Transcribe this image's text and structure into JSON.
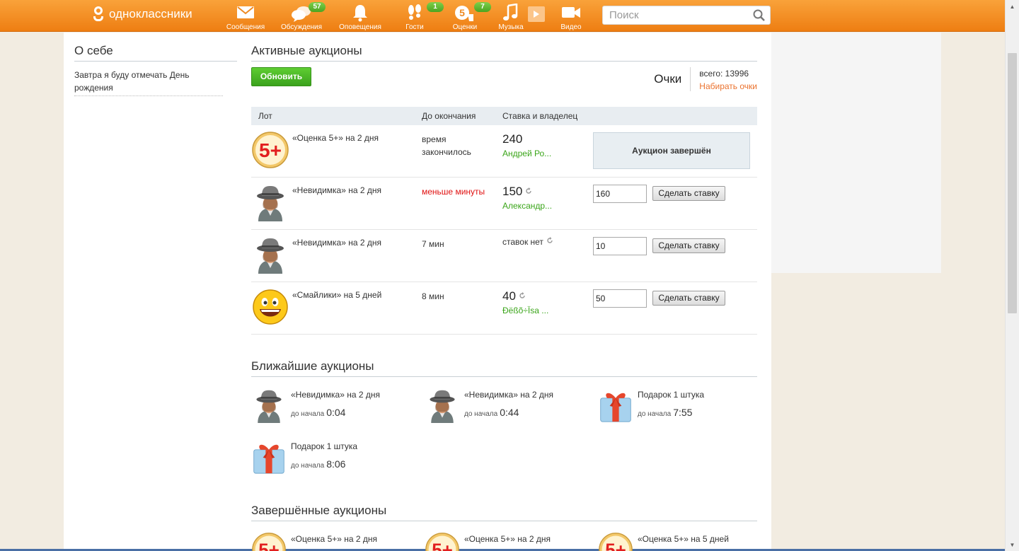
{
  "header": {
    "logo_text": "одноклассники",
    "search_placeholder": "Поиск",
    "nav": [
      {
        "icon": "envelope-icon",
        "label": "Сообщения",
        "badge": ""
      },
      {
        "icon": "chat-bubbles-icon",
        "label": "Обсуждения",
        "badge": "57"
      },
      {
        "icon": "bell-icon",
        "label": "Оповещения",
        "badge": ""
      },
      {
        "icon": "footprints-icon",
        "label": "Гости",
        "badge": "1"
      },
      {
        "icon": "grade-5-icon",
        "label": "Оценки",
        "badge": "7"
      },
      {
        "icon": "music-note-icon",
        "label": "Музыка",
        "badge": ""
      },
      {
        "icon": "video-camera-icon",
        "label": "Видео",
        "badge": ""
      }
    ]
  },
  "about": {
    "title": "О себе",
    "text": "Завтра я буду отмечать День рождения"
  },
  "active": {
    "title": "Активные аукционы",
    "refresh_label": "Обновить",
    "points_label": "Очки",
    "points_total": "всего: 13996",
    "points_link": "Набирать очки",
    "columns": {
      "lot": "Лот",
      "time": "До окончания",
      "bid": "Ставка и владелец"
    },
    "rows": [
      {
        "icon": "grade-5plus-icon",
        "lot": "«Оценка 5+» на 2 дня",
        "time": "время закончилось",
        "amount": "240",
        "owner": "Андрей Ро...",
        "status": "Аукцион завершён"
      },
      {
        "icon": "invisible-hat-icon",
        "lot": "«Невидимка» на 2 дня",
        "time": "меньше минуты",
        "amount": "150",
        "owner": "Александр...",
        "input": "160",
        "button": "Сделать ставку"
      },
      {
        "icon": "invisible-hat-icon",
        "lot": "«Невидимка» на 2 дня",
        "time": "7 мин",
        "amount_text": "ставок нет",
        "input": "10",
        "button": "Сделать ставку"
      },
      {
        "icon": "smiley-icon",
        "lot": "«Смайлики» на 5 дней",
        "time": "8 мин",
        "amount": "40",
        "owner": "Ðëßõ÷Ïsa ...",
        "input": "50",
        "button": "Сделать ставку"
      }
    ]
  },
  "upcoming": {
    "title": "Ближайшие аукционы",
    "prefix": "до начала",
    "items": [
      {
        "icon": "invisible-hat-icon",
        "name": "«Невидимка» на 2 дня",
        "time": "0:04"
      },
      {
        "icon": "invisible-hat-icon",
        "name": "«Невидимка» на 2 дня",
        "time": "0:44"
      },
      {
        "icon": "gift-box-icon",
        "name": "Подарок 1 штука",
        "time": "7:55"
      },
      {
        "icon": "gift-box-icon",
        "name": "Подарок 1 штука",
        "time": "8:06"
      }
    ]
  },
  "finished": {
    "title": "Завершённые аукционы",
    "items": [
      {
        "icon": "grade-5plus-icon",
        "name": "«Оценка 5+» на 2 дня"
      },
      {
        "icon": "grade-5plus-icon",
        "name": "«Оценка 5+» на 2 дня"
      },
      {
        "icon": "grade-5plus-icon",
        "name": "«Оценка 5+» на 5 дней"
      }
    ]
  },
  "colors": {
    "brand": "#ee7e12",
    "accent_green": "#3aa519",
    "link_orange": "#eb722e",
    "alert_red": "#e01010"
  }
}
